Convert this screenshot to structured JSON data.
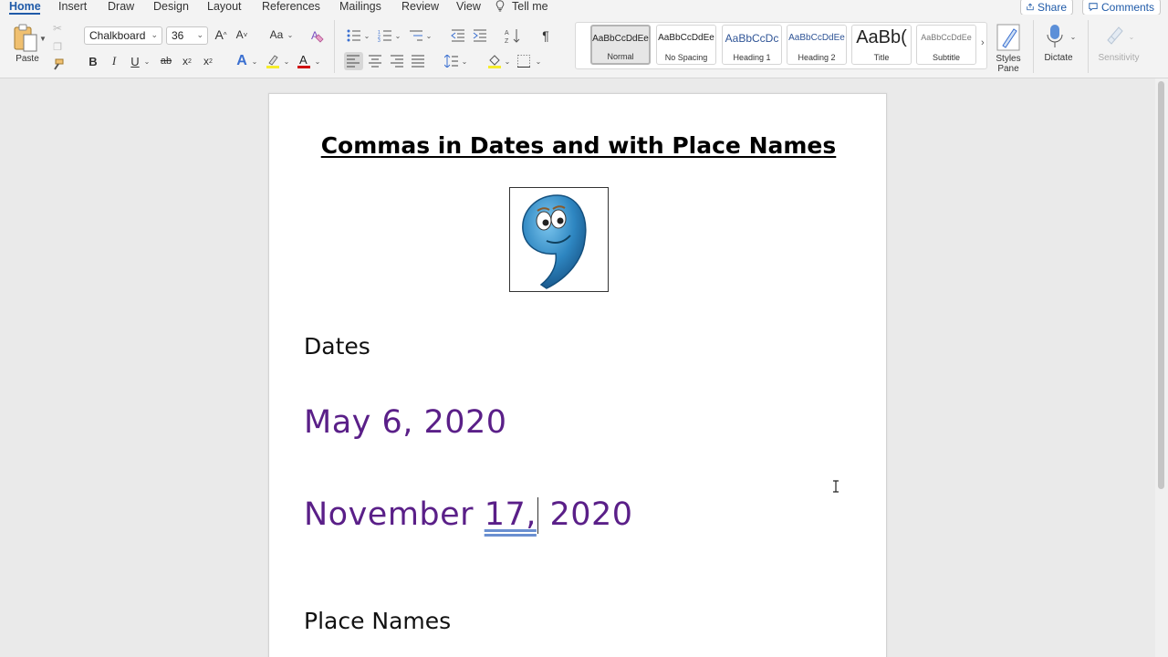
{
  "tabs": [
    "Home",
    "Insert",
    "Draw",
    "Design",
    "Layout",
    "References",
    "Mailings",
    "Review",
    "View",
    "Tell me"
  ],
  "actions": {
    "share": "Share",
    "comments": "Comments"
  },
  "ribbon": {
    "paste_label": "Paste",
    "font_name": "Chalkboard",
    "font_size": "36",
    "font_controls": {
      "grow": "A",
      "shrink": "A",
      "change_case": "Aa",
      "bold": "B",
      "italic": "I",
      "underline": "U",
      "strike": "ab",
      "subscript": "x",
      "superscript": "x",
      "font_color": "A",
      "text_effects": "A"
    },
    "pilcrow": "¶",
    "styles": [
      {
        "preview": "AaBbCcDdEe",
        "name": "Normal"
      },
      {
        "preview": "AaBbCcDdEe",
        "name": "No Spacing"
      },
      {
        "preview": "AaBbCcDc",
        "name": "Heading 1"
      },
      {
        "preview": "AaBbCcDdEe",
        "name": "Heading 2"
      },
      {
        "preview": "AaBb(",
        "name": "Title"
      },
      {
        "preview": "AaBbCcDdEe",
        "name": "Subtitle"
      }
    ],
    "styles_pane_label": "Styles Pane",
    "dictate_label": "Dictate",
    "sensitivity_label": "Sensitivity"
  },
  "document": {
    "title": "Commas in Dates and with Place Names",
    "heading_dates": "Dates",
    "date1": "May 6, 2020",
    "date2_part1": "November ",
    "date2_underlined": "17,",
    "date2_part2": " 2020",
    "heading_places": "Place Names"
  },
  "colors": {
    "accent": "#1f5aa8",
    "date_text": "#5a1f88",
    "page_bg": "#ffffff",
    "app_bg": "#eaeaea"
  },
  "icons": [
    "lightbulb-icon",
    "share-icon",
    "comments-icon",
    "paste-icon",
    "cut-icon",
    "copy-icon",
    "format-painter-icon",
    "clear-formatting-icon",
    "bullets-icon",
    "numbering-icon",
    "multilevel-list-icon",
    "decrease-indent-icon",
    "increase-indent-icon",
    "sort-icon",
    "align-left-icon",
    "align-center-icon",
    "align-right-icon",
    "justify-icon",
    "line-spacing-icon",
    "shading-icon",
    "borders-icon",
    "styles-pane-icon",
    "microphone-icon",
    "sensitivity-icon",
    "comma-character-image",
    "ibeam-cursor-icon"
  ]
}
